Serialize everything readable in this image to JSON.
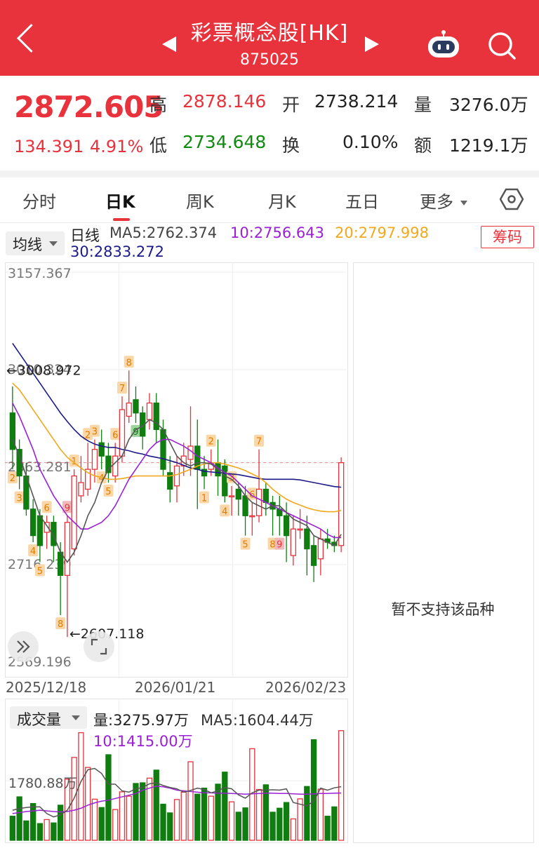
{
  "header": {
    "title": "彩票概念股[HK]",
    "code": "875025"
  },
  "quote": {
    "price": "2872.605",
    "change": "134.391",
    "change_pct": "4.91%",
    "high_label": "高",
    "high": "2878.146",
    "low_label": "低",
    "low": "2734.648",
    "open_label": "开",
    "open": "2738.214",
    "turnover_label": "换",
    "turnover": "0.10%",
    "volume_label": "量",
    "volume": "3276.0万",
    "amount_label": "额",
    "amount": "1219.1万"
  },
  "tabs": [
    "分时",
    "日K",
    "周K",
    "月K",
    "五日",
    "更多"
  ],
  "active_tab": "日K",
  "indicator": {
    "dropdown": "均线",
    "line_label": "日线",
    "ma5": "MA5:2762.374",
    "ma10": "10:2756.643",
    "ma20": "20:2797.998",
    "ma30": "30:2833.272",
    "chip_button": "筹码"
  },
  "price_axis": {
    "top": "3157.367",
    "upper": "3010.324",
    "mid": "2863.281",
    "lower": "2716.239",
    "bottom": "2569.196"
  },
  "annotations": {
    "high_marker": "←3008.972",
    "low_marker": "←2607.118"
  },
  "dates": [
    "2025/12/18",
    "2026/01/21",
    "2026/02/23"
  ],
  "side_panel": {
    "message": "暂不支持该品种"
  },
  "volume": {
    "dropdown": "成交量",
    "value": "量:3275.97万",
    "ma5": "MA5:1604.44万",
    "ma10": "10:1415.00万",
    "axis_label": "1780.88万"
  },
  "colors": {
    "up": "#e8323c",
    "down": "#0f7d0f",
    "ma5": "#555555",
    "ma10": "#9b1fd6",
    "ma20": "#f2a81d",
    "ma30": "#1c1a8a"
  },
  "chart_data": {
    "type": "candlestick",
    "ylim": [
      2569.196,
      3157.367
    ],
    "candles": [
      {
        "o": 2945,
        "c": 2890,
        "h": 2985,
        "l": 2860,
        "num": "2"
      },
      {
        "o": 2890,
        "c": 2850,
        "h": 2905,
        "l": 2830,
        "num": "3"
      },
      {
        "o": 2850,
        "c": 2800,
        "h": 2870,
        "l": 2790,
        "num": ""
      },
      {
        "o": 2800,
        "c": 2760,
        "h": 2815,
        "l": 2750,
        "num": "4"
      },
      {
        "o": 2790,
        "c": 2745,
        "h": 2800,
        "l": 2720,
        "num": "5"
      },
      {
        "o": 2765,
        "c": 2780,
        "h": 2790,
        "l": 2740,
        "num": "6"
      },
      {
        "o": 2780,
        "c": 2745,
        "h": 2790,
        "l": 2720,
        "num": ""
      },
      {
        "o": 2735,
        "c": 2700,
        "h": 2750,
        "l": 2640,
        "num": "8"
      },
      {
        "o": 2700,
        "c": 2780,
        "h": 2790,
        "l": 2607,
        "num": "9"
      },
      {
        "o": 2740,
        "c": 2850,
        "h": 2860,
        "l": 2730,
        "num": "1"
      },
      {
        "o": 2820,
        "c": 2840,
        "h": 2880,
        "l": 2810,
        "num": ""
      },
      {
        "o": 2830,
        "c": 2860,
        "h": 2900,
        "l": 2820,
        "num": "2"
      },
      {
        "o": 2860,
        "c": 2890,
        "h": 2905,
        "l": 2840,
        "num": "3"
      },
      {
        "o": 2900,
        "c": 2880,
        "h": 2920,
        "l": 2860,
        "num": "4"
      },
      {
        "o": 2880,
        "c": 2855,
        "h": 2900,
        "l": 2840,
        "num": "5"
      },
      {
        "o": 2850,
        "c": 2880,
        "h": 2900,
        "l": 2840,
        "num": "6"
      },
      {
        "o": 2880,
        "c": 2950,
        "h": 2970,
        "l": 2870,
        "num": "7"
      },
      {
        "o": 2940,
        "c": 2960,
        "h": 3009,
        "l": 2930,
        "num": "8"
      },
      {
        "o": 2965,
        "c": 2945,
        "h": 2985,
        "l": 2930,
        "num": "9"
      },
      {
        "o": 2945,
        "c": 2910,
        "h": 2955,
        "l": 2890,
        "num": ""
      },
      {
        "o": 2935,
        "c": 2960,
        "h": 2975,
        "l": 2920,
        "num": ""
      },
      {
        "o": 2960,
        "c": 2920,
        "h": 2975,
        "l": 2900,
        "num": ""
      },
      {
        "o": 2920,
        "c": 2860,
        "h": 2935,
        "l": 2850,
        "num": ""
      },
      {
        "o": 2855,
        "c": 2830,
        "h": 2880,
        "l": 2810,
        "num": ""
      },
      {
        "o": 2835,
        "c": 2865,
        "h": 2880,
        "l": 2810,
        "num": ""
      },
      {
        "o": 2865,
        "c": 2880,
        "h": 2900,
        "l": 2850,
        "num": ""
      },
      {
        "o": 2875,
        "c": 2895,
        "h": 2955,
        "l": 2850,
        "num": ""
      },
      {
        "o": 2895,
        "c": 2860,
        "h": 2935,
        "l": 2800,
        "num": ""
      },
      {
        "o": 2860,
        "c": 2850,
        "h": 2880,
        "l": 2830,
        "num": "1"
      },
      {
        "o": 2860,
        "c": 2870,
        "h": 2890,
        "l": 2850,
        "num": "2"
      },
      {
        "o": 2870,
        "c": 2850,
        "h": 2905,
        "l": 2820,
        "num": ""
      },
      {
        "o": 2865,
        "c": 2820,
        "h": 2875,
        "l": 2810,
        "num": "4"
      },
      {
        "o": 2820,
        "c": 2820,
        "h": 2835,
        "l": 2790,
        "num": "3"
      },
      {
        "o": 2830,
        "c": 2815,
        "h": 2840,
        "l": 2790,
        "num": ""
      },
      {
        "o": 2820,
        "c": 2790,
        "h": 2835,
        "l": 2760,
        "num": "5"
      },
      {
        "o": 2790,
        "c": 2790,
        "h": 2810,
        "l": 2760,
        "num": "6"
      },
      {
        "o": 2790,
        "c": 2830,
        "h": 2890,
        "l": 2780,
        "num": "7"
      },
      {
        "o": 2830,
        "c": 2810,
        "h": 2840,
        "l": 2790,
        "num": ""
      },
      {
        "o": 2810,
        "c": 2800,
        "h": 2820,
        "l": 2760,
        "num": "8"
      },
      {
        "o": 2800,
        "c": 2790,
        "h": 2820,
        "l": 2760,
        "num": "9"
      },
      {
        "o": 2790,
        "c": 2760,
        "h": 2810,
        "l": 2720,
        "num": ""
      },
      {
        "o": 2730,
        "c": 2770,
        "h": 2790,
        "l": 2715,
        "num": ""
      },
      {
        "o": 2770,
        "c": 2770,
        "h": 2800,
        "l": 2755,
        "num": ""
      },
      {
        "o": 2770,
        "c": 2740,
        "h": 2790,
        "l": 2700,
        "num": ""
      },
      {
        "o": 2745,
        "c": 2715,
        "h": 2760,
        "l": 2690,
        "num": ""
      },
      {
        "o": 2725,
        "c": 2755,
        "h": 2770,
        "l": 2700,
        "num": ""
      },
      {
        "o": 2755,
        "c": 2750,
        "h": 2770,
        "l": 2740,
        "num": ""
      },
      {
        "o": 2750,
        "c": 2745,
        "h": 2760,
        "l": 2735,
        "num": ""
      },
      {
        "o": 2745,
        "c": 2870,
        "h": 2878,
        "l": 2735,
        "num": ""
      }
    ],
    "ma5": [
      2905,
      2880,
      2850,
      2820,
      2790,
      2775,
      2760,
      2735,
      2720,
      2735,
      2760,
      2790,
      2810,
      2840,
      2860,
      2870,
      2880,
      2905,
      2920,
      2925,
      2935,
      2930,
      2920,
      2900,
      2880,
      2870,
      2865,
      2870,
      2870,
      2868,
      2860,
      2850,
      2845,
      2835,
      2820,
      2810,
      2805,
      2800,
      2805,
      2805,
      2795,
      2785,
      2780,
      2775,
      2760,
      2755,
      2750,
      2745,
      2762
    ],
    "ma10": [
      2960,
      2940,
      2915,
      2890,
      2860,
      2840,
      2820,
      2805,
      2790,
      2780,
      2770,
      2770,
      2775,
      2780,
      2790,
      2805,
      2825,
      2845,
      2860,
      2875,
      2890,
      2900,
      2905,
      2905,
      2900,
      2895,
      2888,
      2880,
      2875,
      2870,
      2862,
      2855,
      2850,
      2840,
      2830,
      2820,
      2815,
      2810,
      2805,
      2800,
      2795,
      2790,
      2785,
      2780,
      2775,
      2770,
      2762,
      2757,
      2757
    ],
    "ma20": [
      2990,
      2980,
      2965,
      2950,
      2935,
      2920,
      2905,
      2890,
      2878,
      2870,
      2862,
      2855,
      2850,
      2848,
      2845,
      2845,
      2846,
      2848,
      2850,
      2850,
      2850,
      2850,
      2850,
      2850,
      2852,
      2856,
      2860,
      2865,
      2868,
      2870,
      2870,
      2868,
      2865,
      2862,
      2858,
      2853,
      2848,
      2840,
      2830,
      2822,
      2815,
      2810,
      2806,
      2802,
      2799,
      2797,
      2796,
      2796,
      2798
    ],
    "ma30": [
      3050,
      3035,
      3020,
      3005,
      2990,
      2975,
      2960,
      2945,
      2932,
      2920,
      2910,
      2903,
      2898,
      2895,
      2893,
      2893,
      2890,
      2888,
      2885,
      2883,
      2880,
      2878,
      2876,
      2873,
      2870,
      2866,
      2862,
      2860,
      2857,
      2856,
      2855,
      2854,
      2853,
      2852,
      2850,
      2848,
      2846,
      2845,
      2845,
      2845,
      2845,
      2845,
      2844,
      2842,
      2840,
      2838,
      2836,
      2834,
      2833
    ],
    "volume": [
      720,
      1300,
      580,
      1100,
      500,
      620,
      520,
      1050,
      1830,
      2480,
      3220,
      2180,
      1230,
      980,
      2560,
      920,
      1450,
      1320,
      1700,
      1720,
      1860,
      2100,
      1080,
      820,
      1220,
      1440,
      2350,
      1380,
      1560,
      1320,
      1680,
      2040,
      1150,
      840,
      970,
      2740,
      1520,
      1660,
      840,
      960,
      1130,
      640,
      1240,
      1610,
      3010,
      1530,
      720,
      1000,
      3280
    ],
    "vol_ma5": [
      900,
      950,
      980,
      1000,
      1000,
      800,
      700,
      760,
      900,
      1260,
      1760,
      2110,
      2150,
      2000,
      1680,
      1680,
      1480,
      1440,
      1540,
      1580,
      1690,
      1720,
      1640,
      1580,
      1540,
      1440,
      1490,
      1560,
      1520,
      1420,
      1480,
      1580,
      1540,
      1360,
      1260,
      1420,
      1500,
      1500,
      1510,
      1500,
      1540,
      1130,
      1080,
      1030,
      1170,
      1560,
      1500,
      1570,
      1604
    ],
    "vol_ma10": [
      800,
      830,
      860,
      880,
      900,
      880,
      860,
      850,
      860,
      900,
      960,
      1050,
      1120,
      1170,
      1200,
      1250,
      1300,
      1350,
      1400,
      1500,
      1560,
      1620,
      1600,
      1560,
      1500,
      1480,
      1460,
      1440,
      1420,
      1420,
      1410,
      1410,
      1400,
      1390,
      1380,
      1390,
      1400,
      1410,
      1410,
      1400,
      1400,
      1390,
      1380,
      1380,
      1390,
      1400,
      1400,
      1410,
      1415
    ]
  }
}
